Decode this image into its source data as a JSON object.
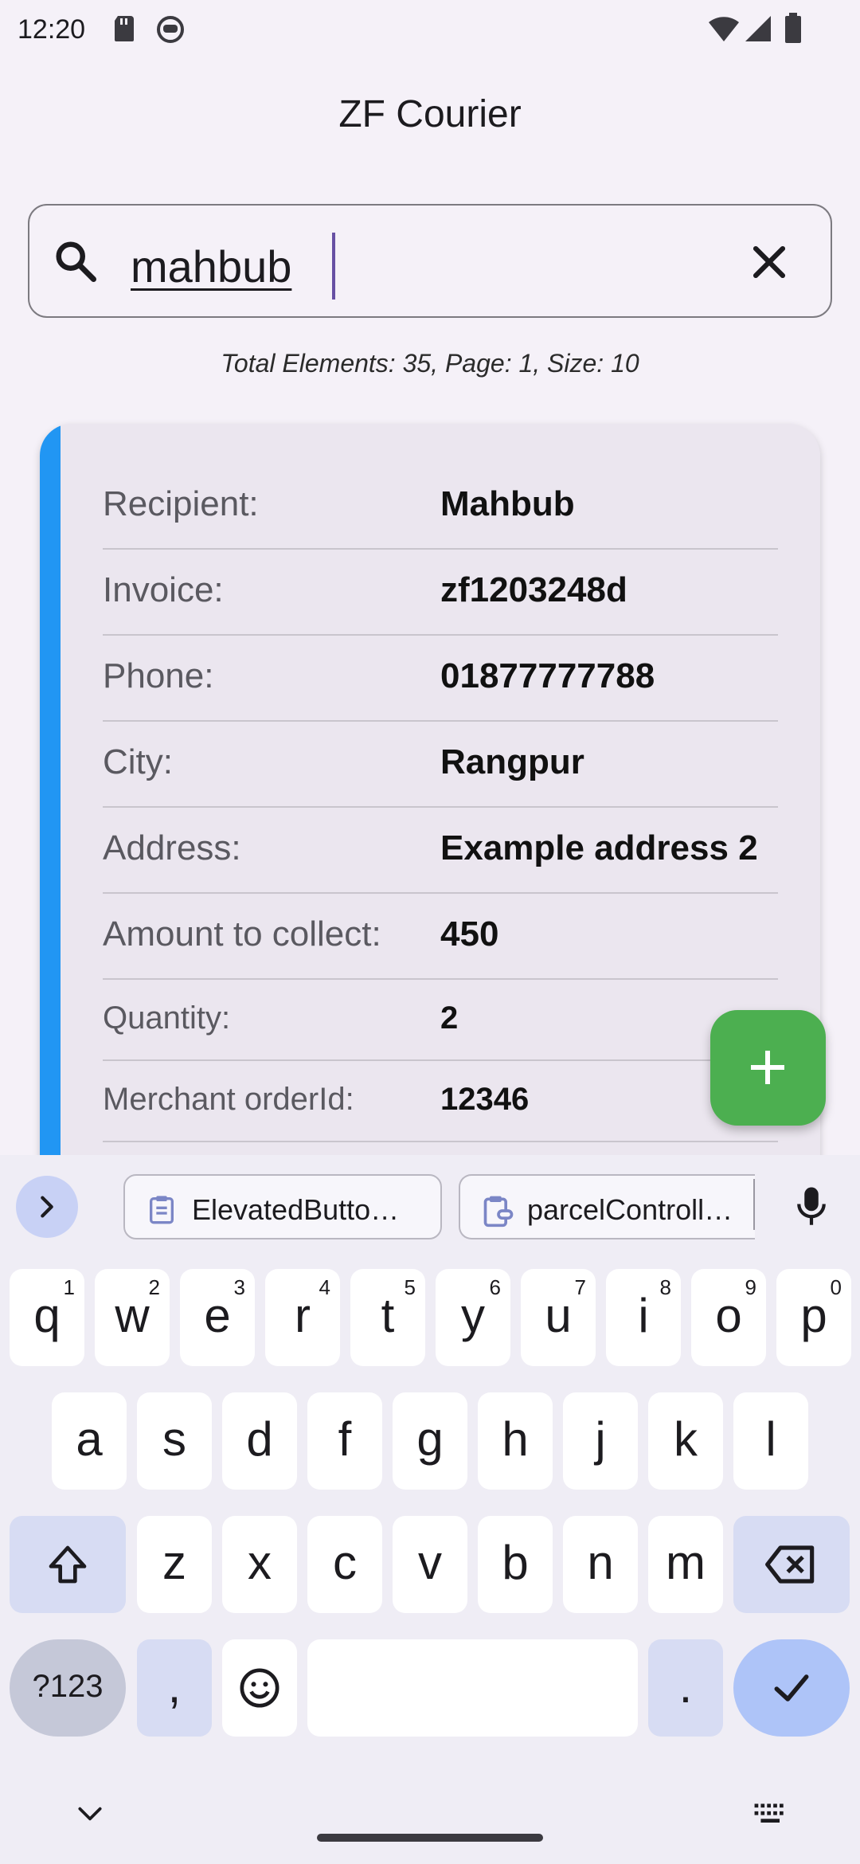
{
  "status_bar": {
    "time": "12:20"
  },
  "app": {
    "title": "ZF Courier"
  },
  "search": {
    "value": "mahbub"
  },
  "page_info": "Total Elements: 35, Page: 1, Size: 10",
  "card": {
    "accent_color": "#2196F3",
    "rows": [
      {
        "label": "Recipient:",
        "value": "Mahbub"
      },
      {
        "label": "Invoice:",
        "value": "zf1203248d"
      },
      {
        "label": "Phone:",
        "value": "01877777788"
      },
      {
        "label": "City:",
        "value": "Rangpur"
      },
      {
        "label": "Address:",
        "value": "Example address 2"
      },
      {
        "label": "Amount to collect:",
        "value": "450"
      },
      {
        "label": "Quantity:",
        "value": "2"
      },
      {
        "label": "Merchant orderId:",
        "value": "12346"
      }
    ]
  },
  "fab": {
    "icon": "plus-icon",
    "color": "#4CAF50"
  },
  "keyboard": {
    "clipboard_chips": [
      "ElevatedButto…",
      "parcelControll…"
    ],
    "row1": [
      {
        "key": "q",
        "hint": "1"
      },
      {
        "key": "w",
        "hint": "2"
      },
      {
        "key": "e",
        "hint": "3"
      },
      {
        "key": "r",
        "hint": "4"
      },
      {
        "key": "t",
        "hint": "5"
      },
      {
        "key": "y",
        "hint": "6"
      },
      {
        "key": "u",
        "hint": "7"
      },
      {
        "key": "i",
        "hint": "8"
      },
      {
        "key": "o",
        "hint": "9"
      },
      {
        "key": "p",
        "hint": "0"
      }
    ],
    "row2": [
      "a",
      "s",
      "d",
      "f",
      "g",
      "h",
      "j",
      "k",
      "l"
    ],
    "row3": [
      "z",
      "x",
      "c",
      "v",
      "b",
      "n",
      "m"
    ],
    "symbols_label": "?123",
    "comma": ",",
    "period": "."
  }
}
